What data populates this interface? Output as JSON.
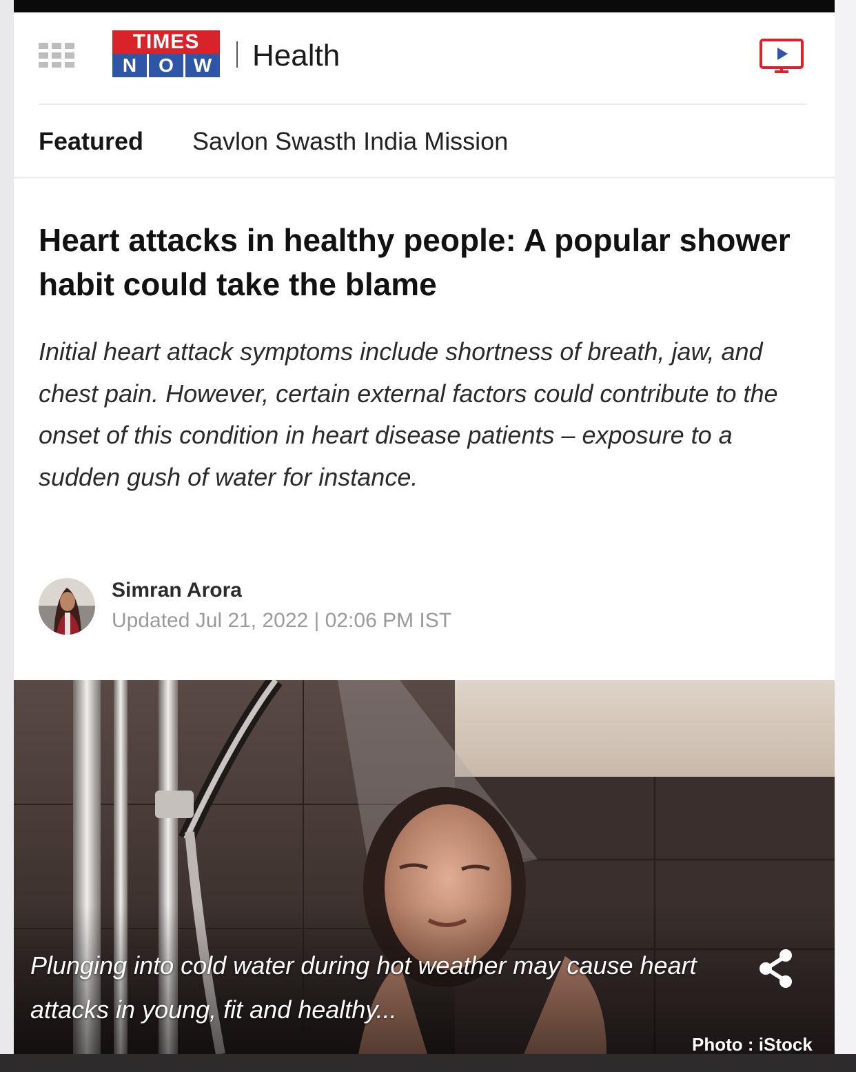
{
  "brand": {
    "logo_line1": "TIMES",
    "logo_line2_letters": [
      "N",
      "O",
      "W"
    ],
    "section": "Health"
  },
  "nav": {
    "featured_label": "Featured",
    "mission_label": "Savlon Swasth India Mission"
  },
  "article": {
    "headline": "Heart attacks in healthy people: A popular shower habit could take the blame",
    "summary": "Initial heart attack symptoms include shortness of breath, jaw, and chest pain. However, certain external factors could contribute to the onset of this condition in heart disease patients – exposure to a sudden gush of water for instance.",
    "author": "Simran Arora",
    "updated": "Updated Jul 21, 2022 | 02:06 PM IST"
  },
  "media": {
    "caption": "Plunging into cold water during hot weather may cause heart attacks in young, fit and healthy...",
    "credit": "Photo : iStock"
  },
  "icons": {
    "menu": "grid-menu-icon",
    "video": "tv-play-icon",
    "share": "share-icon"
  },
  "colors": {
    "times_red": "#d8232a",
    "now_blue": "#2f56a6",
    "top_bar": "#0a0a0a",
    "photo_tile": "#3a2f2d"
  }
}
